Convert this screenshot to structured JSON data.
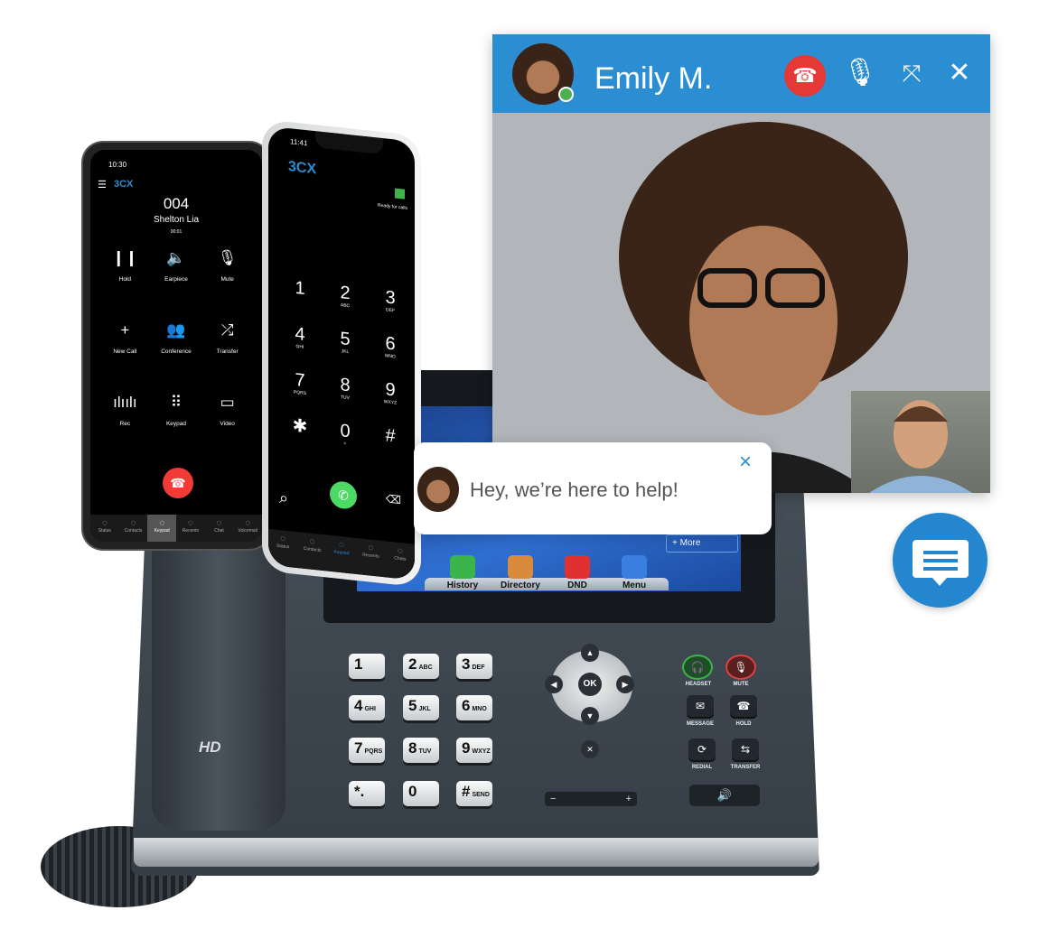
{
  "colors": {
    "brand_blue": "#2b8ed2",
    "hangup_red": "#e53935",
    "call_green": "#4cd964",
    "online_green": "#4caf50"
  },
  "video_call": {
    "contact_name": "Emily M.",
    "status": "online",
    "icons": [
      "hangup-icon",
      "microphone-icon",
      "fullscreen-icon",
      "close-icon"
    ]
  },
  "chat_widget": {
    "message": "Hey, we’re here to help!",
    "close_icon": "×",
    "launcher_icon": "chat-bubble-icon"
  },
  "android_phone": {
    "time": "10:30",
    "logo": "3CX",
    "extension": "004",
    "caller": "Shelton Lia",
    "duration": "00:01",
    "actions": [
      {
        "label": "Hold",
        "icon": "❙❙"
      },
      {
        "label": "Earpiece",
        "icon": "🔈"
      },
      {
        "label": "Mute",
        "icon": "🎙"
      },
      {
        "label": "New Call",
        "icon": "+"
      },
      {
        "label": "Conference",
        "icon": "👥"
      },
      {
        "label": "Transfer",
        "icon": "⤮"
      },
      {
        "label": "Rec",
        "icon": "ılıılı"
      },
      {
        "label": "Keypad",
        "icon": "⠿"
      },
      {
        "label": "Video",
        "icon": "▭"
      }
    ],
    "tabs": [
      "Status",
      "Contacts",
      "Keypad",
      "Recents",
      "Chat",
      "Voicemail"
    ],
    "active_tab": "Keypad"
  },
  "iphone": {
    "time": "11:41",
    "logo": "3CX",
    "status": "Ready for calls",
    "keys": [
      {
        "d": "1",
        "l": ""
      },
      {
        "d": "2",
        "l": "ABC"
      },
      {
        "d": "3",
        "l": "DEF"
      },
      {
        "d": "4",
        "l": "GHI"
      },
      {
        "d": "5",
        "l": "JKL"
      },
      {
        "d": "6",
        "l": "MNO"
      },
      {
        "d": "7",
        "l": "PQRS"
      },
      {
        "d": "8",
        "l": "TUV"
      },
      {
        "d": "9",
        "l": "WXYZ"
      },
      {
        "d": "✱",
        "l": ""
      },
      {
        "d": "0",
        "l": "+"
      },
      {
        "d": "#",
        "l": ""
      }
    ],
    "tabs": [
      "Status",
      "Contacts",
      "Keypad",
      "Recents",
      "Chats"
    ],
    "active_tab": "Keypad"
  },
  "desk_phone": {
    "brand_mark": "HD",
    "screen_more": "More",
    "screen_apps": [
      "History",
      "Directory",
      "DND",
      "Menu"
    ],
    "keys": [
      {
        "d": "1",
        "l": ""
      },
      {
        "d": "2",
        "l": "ABC"
      },
      {
        "d": "3",
        "l": "DEF"
      },
      {
        "d": "4",
        "l": "GHI"
      },
      {
        "d": "5",
        "l": "JKL"
      },
      {
        "d": "6",
        "l": "MNO"
      },
      {
        "d": "7",
        "l": "PQRS"
      },
      {
        "d": "8",
        "l": "TUV"
      },
      {
        "d": "9",
        "l": "WXYZ"
      },
      {
        "d": "*.",
        "l": ""
      },
      {
        "d": "0",
        "l": ""
      },
      {
        "d": "#",
        "l": "SEND"
      }
    ],
    "nav_ok": "OK",
    "function_keys": [
      "HEADSET",
      "MUTE",
      "MESSAGE",
      "HOLD",
      "REDIAL",
      "TRANSFER"
    ],
    "volume": {
      "minus": "−",
      "plus": "+"
    }
  }
}
